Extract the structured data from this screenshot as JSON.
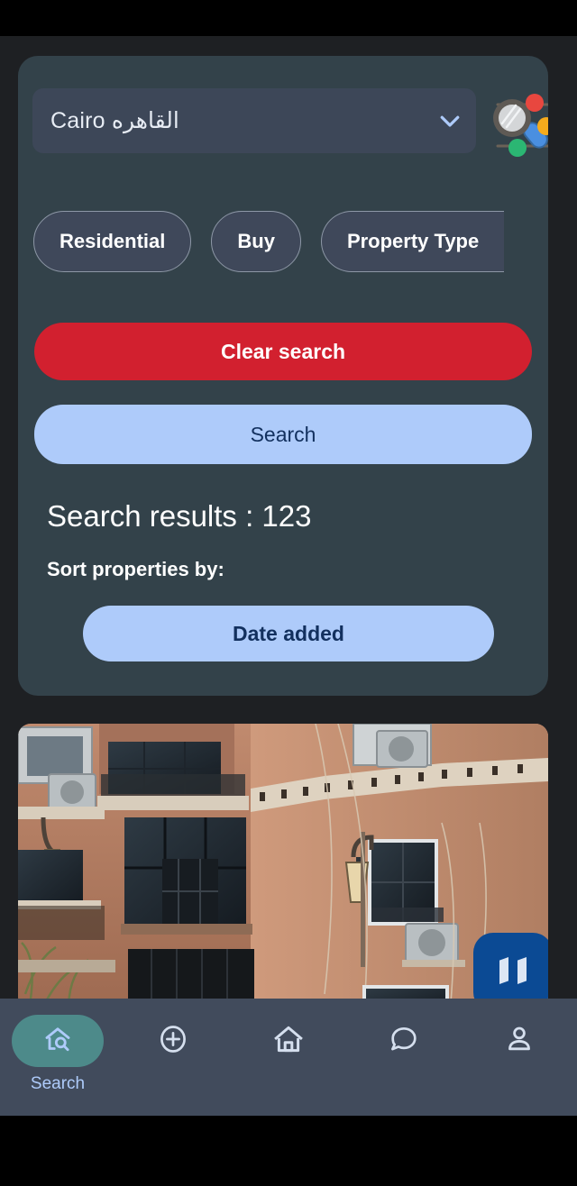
{
  "search_panel": {
    "city_select": {
      "name": "city-dropdown",
      "value": "Cairo القاهره",
      "chevron_icon": "chevron-down-icon"
    },
    "filter_illustration_icon": "search-filter-illustration-icon",
    "chips": [
      {
        "label": "Residential",
        "name": "chip-residential"
      },
      {
        "label": "Buy",
        "name": "chip-buy"
      },
      {
        "label": "Property Type",
        "name": "chip-property-type"
      }
    ],
    "clear_button_label": "Clear search",
    "search_button_label": "Search",
    "results_title": "Search results : 123",
    "sort_label": "Sort properties by:",
    "sort_value": "Date added"
  },
  "property_card": {
    "map_button_icon": "map-icon"
  },
  "bottom_nav": [
    {
      "name": "nav-search",
      "icon": "house-search-icon",
      "label": "Search",
      "active": true
    },
    {
      "name": "nav-add",
      "icon": "plus-circle-icon",
      "label": "",
      "active": false
    },
    {
      "name": "nav-home",
      "icon": "home-icon",
      "label": "",
      "active": false
    },
    {
      "name": "nav-messages",
      "icon": "chat-bubble-icon",
      "label": "",
      "active": false
    },
    {
      "name": "nav-profile",
      "icon": "person-icon",
      "label": "",
      "active": false
    }
  ],
  "colors": {
    "card_bg": "#33424a",
    "page_bg": "#1e2023",
    "chip_bg": "#3f485a",
    "clear_red": "#d2202f",
    "action_blue": "#aecbfa",
    "action_blue_text": "#12305e",
    "nav_bg": "#414b5c",
    "nav_active_pill": "#4d8a8a",
    "map_fab_blue": "#0b4a94"
  }
}
